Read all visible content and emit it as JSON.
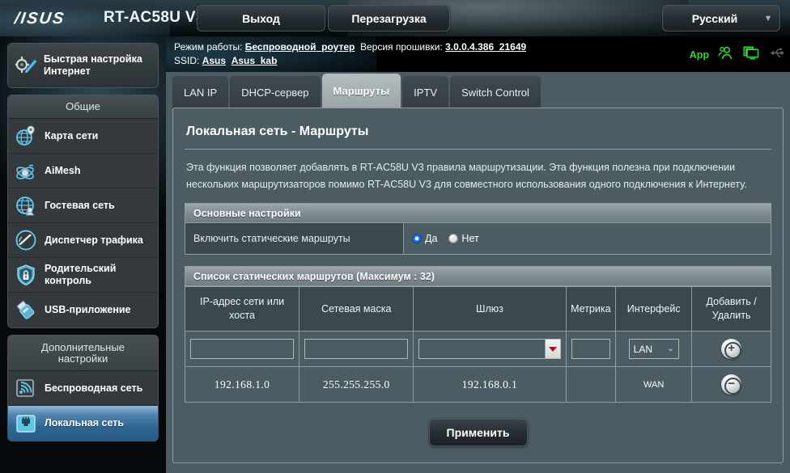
{
  "header": {
    "brand": "/ISUS",
    "model": "RT-AC58U V3",
    "logout_label": "Выход",
    "reboot_label": "Перезагрузка",
    "language": "Русский"
  },
  "infobar": {
    "mode_label": "Режим работы:",
    "mode_value": "Беспроводной_роутер",
    "fw_label": "Версия прошивки:",
    "fw_value": "3.0.0.4.386_21649",
    "ssid_label": "SSID:",
    "ssid_1": "Asus",
    "ssid_2": "Asus_kab",
    "app_label": "App",
    "accent_green": "#2fd82f"
  },
  "tabs": [
    {
      "label": "LAN IP",
      "active": false
    },
    {
      "label": "DHCP-сервер",
      "active": false
    },
    {
      "label": "Маршруты",
      "active": true
    },
    {
      "label": "IPTV",
      "active": false
    },
    {
      "label": "Switch Control",
      "active": false
    }
  ],
  "sidebar": {
    "quick": {
      "line1": "Быстрая настройка",
      "line2": "Интернет"
    },
    "group1_title": "Общие",
    "group1_items": [
      {
        "label": "Карта сети",
        "icon": "globe-pin-icon",
        "active": false
      },
      {
        "label": "AiMesh",
        "icon": "aimesh-icon",
        "active": false
      },
      {
        "label": "Гостевая сеть",
        "icon": "globe-guest-icon",
        "active": false
      },
      {
        "label": "Диспетчер трафика",
        "icon": "speedometer-icon",
        "active": false
      },
      {
        "label": "Родительский контроль",
        "icon": "shield-lock-icon",
        "active": false
      },
      {
        "label": "USB-приложение",
        "icon": "usb-stick-icon",
        "active": false
      }
    ],
    "group2_title_l1": "Дополнительные",
    "group2_title_l2": "настройки",
    "group2_items": [
      {
        "label": "Беспроводная сеть",
        "icon": "wireless-icon",
        "active": false
      },
      {
        "label": "Локальная сеть",
        "icon": "lan-port-icon",
        "active": true
      }
    ],
    "active_color": "#3f7bb0"
  },
  "page": {
    "title": "Локальная сеть - Маршруты",
    "description": "Эта функция позволяет добавлять в RT-AC58U V3 правила маршрутизации. Эта функция полезна при подключении нескольких маршрутизаторов помимо RT-AC58U V3 для совместного использования одного подключения к Интернету.",
    "basic_section_title": "Основные настройки",
    "enable_static_label": "Включить статические маршруты",
    "radio_yes": "Да",
    "radio_no": "Нет",
    "radio_selected": "Да",
    "list_section_title": "Список статических маршрутов (Максимум : 32)",
    "apply_label": "Применить"
  },
  "table": {
    "headers": [
      "IP-адрес сети или хоста",
      "Сетевая маска",
      "Шлюз",
      "Метрика",
      "Интерфейс",
      "Добавить / Удалить"
    ],
    "header_add_delete_l1": "Добавить /",
    "header_add_delete_l2": "Удалить",
    "input_row": {
      "ip": "",
      "netmask": "",
      "gateway": "",
      "metric": "",
      "interface": "LAN",
      "action_glyph": "+"
    },
    "rows": [
      {
        "ip": "192.168.1.0",
        "netmask": "255.255.255.0",
        "gateway": "192.168.0.1",
        "metric": "",
        "interface": "WAN",
        "action_glyph": "−"
      }
    ]
  }
}
